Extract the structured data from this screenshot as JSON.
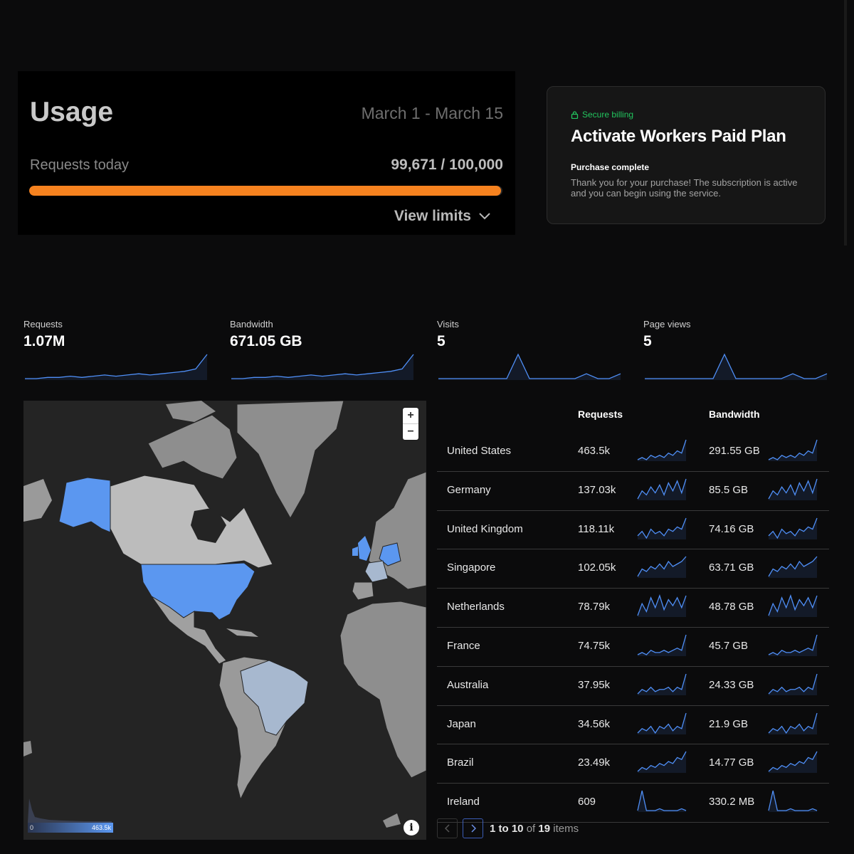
{
  "usage": {
    "title": "Usage",
    "date_range": "March 1 - March 15",
    "requests_label": "Requests today",
    "requests_value": "99,671 / 100,000",
    "progress_fraction": 0.9967,
    "view_limits_label": "View limits",
    "accent_color": "#f6821f"
  },
  "billing": {
    "badge": "Secure billing",
    "title": "Activate Workers Paid Plan",
    "subtitle": "Purchase complete",
    "message": "Thank you for your purchase! The subscription is active and you can begin using the service."
  },
  "stats": [
    {
      "label": "Requests",
      "value": "1.07M",
      "trend": [
        2,
        2,
        3,
        3,
        4,
        3,
        4,
        5,
        4,
        5,
        6,
        5,
        6,
        7,
        8,
        10,
        22
      ]
    },
    {
      "label": "Bandwidth",
      "value": "671.05 GB",
      "trend": [
        2,
        2,
        3,
        3,
        4,
        3,
        4,
        5,
        4,
        5,
        6,
        5,
        6,
        7,
        8,
        10,
        22
      ]
    },
    {
      "label": "Visits",
      "value": "5",
      "trend": [
        0,
        0,
        0,
        0,
        0,
        0,
        0,
        5,
        0,
        0,
        0,
        0,
        0,
        1,
        0,
        0,
        1
      ]
    },
    {
      "label": "Page views",
      "value": "5",
      "trend": [
        0,
        0,
        0,
        0,
        0,
        0,
        0,
        5,
        0,
        0,
        0,
        0,
        0,
        1,
        0,
        0,
        1
      ]
    }
  ],
  "map": {
    "legend_min": "0",
    "legend_max": "463.5k",
    "zoom_in": "+",
    "zoom_out": "−",
    "info": "i"
  },
  "table": {
    "columns": [
      "Requests",
      "Bandwidth"
    ],
    "rows": [
      {
        "country": "United States",
        "requests": "463.5k",
        "bandwidth": "291.55 GB",
        "trend": [
          3,
          4,
          3,
          5,
          4,
          5,
          4,
          6,
          5,
          7,
          6,
          12
        ]
      },
      {
        "country": "Germany",
        "requests": "137.03k",
        "bandwidth": "85.5 GB",
        "trend": [
          2,
          6,
          4,
          8,
          5,
          9,
          4,
          10,
          6,
          11,
          5,
          12
        ]
      },
      {
        "country": "United Kingdom",
        "requests": "118.11k",
        "bandwidth": "74.16 GB",
        "trend": [
          4,
          6,
          3,
          7,
          5,
          6,
          4,
          7,
          6,
          8,
          7,
          12
        ]
      },
      {
        "country": "Singapore",
        "requests": "102.05k",
        "bandwidth": "63.71 GB",
        "trend": [
          3,
          6,
          5,
          7,
          6,
          8,
          6,
          9,
          7,
          8,
          9,
          11
        ]
      },
      {
        "country": "Netherlands",
        "requests": "78.79k",
        "bandwidth": "48.78 GB",
        "trend": [
          2,
          8,
          4,
          11,
          6,
          12,
          5,
          10,
          7,
          11,
          6,
          12
        ]
      },
      {
        "country": "France",
        "requests": "74.75k",
        "bandwidth": "45.7 GB",
        "trend": [
          3,
          4,
          3,
          5,
          4,
          4,
          5,
          4,
          5,
          6,
          5,
          12
        ]
      },
      {
        "country": "Australia",
        "requests": "37.95k",
        "bandwidth": "24.33 GB",
        "trend": [
          3,
          5,
          4,
          6,
          4,
          5,
          5,
          6,
          4,
          6,
          5,
          12
        ]
      },
      {
        "country": "Japan",
        "requests": "34.56k",
        "bandwidth": "21.9 GB",
        "trend": [
          3,
          5,
          4,
          6,
          3,
          6,
          5,
          7,
          4,
          6,
          5,
          12
        ]
      },
      {
        "country": "Brazil",
        "requests": "23.49k",
        "bandwidth": "14.77 GB",
        "trend": [
          2,
          4,
          3,
          5,
          4,
          6,
          5,
          7,
          6,
          9,
          8,
          12
        ]
      },
      {
        "country": "Ireland",
        "requests": "609",
        "bandwidth": "330.2 MB",
        "trend": [
          1,
          12,
          1,
          1,
          1,
          2,
          1,
          1,
          1,
          1,
          2,
          1
        ]
      }
    ]
  },
  "pagination": {
    "range": "1 to 10",
    "of_word": "of",
    "total": "19",
    "suffix": "items"
  },
  "colors": {
    "spark": "#4f8ff7",
    "map_highlight": "#5b97f0",
    "map_light": "#a7b8cf"
  }
}
